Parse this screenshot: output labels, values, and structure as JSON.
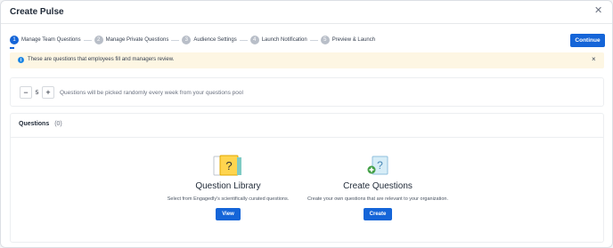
{
  "modal": {
    "title": "Create Pulse",
    "close_icon": "close-icon"
  },
  "steps": [
    {
      "number": "1",
      "label": "Manage Team Questions",
      "active": true
    },
    {
      "number": "2",
      "label": "Manage Private Questions",
      "active": false
    },
    {
      "number": "3",
      "label": "Audience Settings",
      "active": false
    },
    {
      "number": "4",
      "label": "Launch Notification",
      "active": false
    },
    {
      "number": "5",
      "label": "Preview & Launch",
      "active": false
    }
  ],
  "continue_label": "Continue",
  "banner": {
    "icon": "info-icon",
    "text": "These are questions that employees fill and managers review.",
    "close": "×"
  },
  "quantity": {
    "minus": "−",
    "value": "5",
    "plus": "+",
    "text": "Questions will be picked randomly every week from your questions pool"
  },
  "questions": {
    "title": "Questions",
    "count": "(0)",
    "library": {
      "icon": "question-library-icon",
      "title": "Question Library",
      "description": "Select from Engagedly's scientifically curated questions.",
      "button": "View"
    },
    "create": {
      "icon": "create-question-icon",
      "title": "Create Questions",
      "description": "Create your own questions that are relevant to your organization.",
      "button": "Create"
    }
  },
  "colors": {
    "primary": "#1565d8",
    "banner_bg": "#fdf6e3",
    "step_inactive": "#b8bec8"
  }
}
